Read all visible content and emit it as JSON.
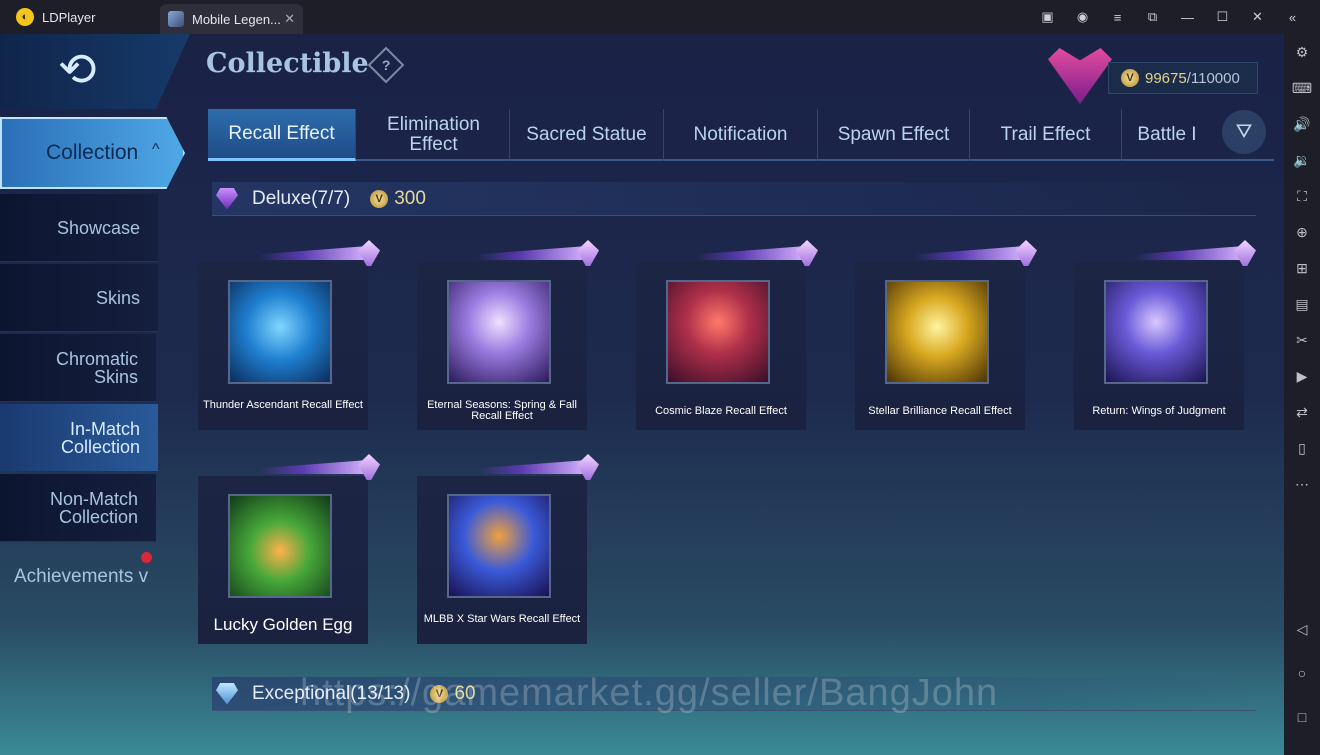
{
  "window": {
    "app_name": "LDPlayer",
    "tab_title": "Mobile Legen...",
    "controls": [
      "gift-icon",
      "account-icon",
      "menu-icon",
      "restore-icon",
      "minimize-icon",
      "maximize-icon",
      "close-icon",
      "collapse-icon"
    ]
  },
  "toolbar": {
    "icons": [
      "settings-icon",
      "keyboard-icon",
      "volume-up-icon",
      "volume-down-icon",
      "screenshot-icon",
      "add-app-icon",
      "multi-instance-icon",
      "apk-icon",
      "scissors-icon",
      "record-icon",
      "sync-icon",
      "shake-icon",
      "more-icon",
      "back-icon",
      "home-icon",
      "recents-icon"
    ]
  },
  "header": {
    "title": "Collectible",
    "help": "?",
    "currency_current": "99675",
    "currency_max": "/110000",
    "coin_symbol": "V"
  },
  "sidebar": {
    "active": "Collection",
    "active_caret": "^",
    "items": [
      {
        "label": "Showcase"
      },
      {
        "label": "Skins"
      },
      {
        "label": "Chromatic Skins"
      },
      {
        "label": "In-Match Collection"
      },
      {
        "label": "Non-Match Collection"
      }
    ],
    "achievements": "Achievements",
    "achievements_caret": "v"
  },
  "tabs": [
    {
      "label": "Recall Effect"
    },
    {
      "label": "Elimination Effect"
    },
    {
      "label": "Sacred Statue"
    },
    {
      "label": "Notification"
    },
    {
      "label": "Spawn Effect"
    },
    {
      "label": "Trail Effect"
    },
    {
      "label": "Battle I"
    }
  ],
  "sections": {
    "deluxe": {
      "title": "Deluxe(7/7)",
      "price": "300"
    },
    "exceptional": {
      "title": "Exceptional(13/13)",
      "price": "60"
    }
  },
  "cards": [
    {
      "name": "Thunder Ascendant Recall Effect",
      "color": "#1f7fd0"
    },
    {
      "name": "Eternal Seasons: Spring & Fall Recall Effect",
      "color": "#7a5ac8"
    },
    {
      "name": "Cosmic Blaze Recall Effect",
      "color": "#b0304a"
    },
    {
      "name": "Stellar Brilliance Recall Effect",
      "color": "#d8a820"
    },
    {
      "name": "Return: Wings of Judgment",
      "color": "#6a5ad8"
    },
    {
      "name": "Lucky Golden Egg",
      "color": "#48a83a"
    },
    {
      "name": "MLBB X Star Wars Recall Effect",
      "color": "#3a5ad8"
    }
  ],
  "watermark": "https://gamemarket.gg/seller/BangJohn"
}
